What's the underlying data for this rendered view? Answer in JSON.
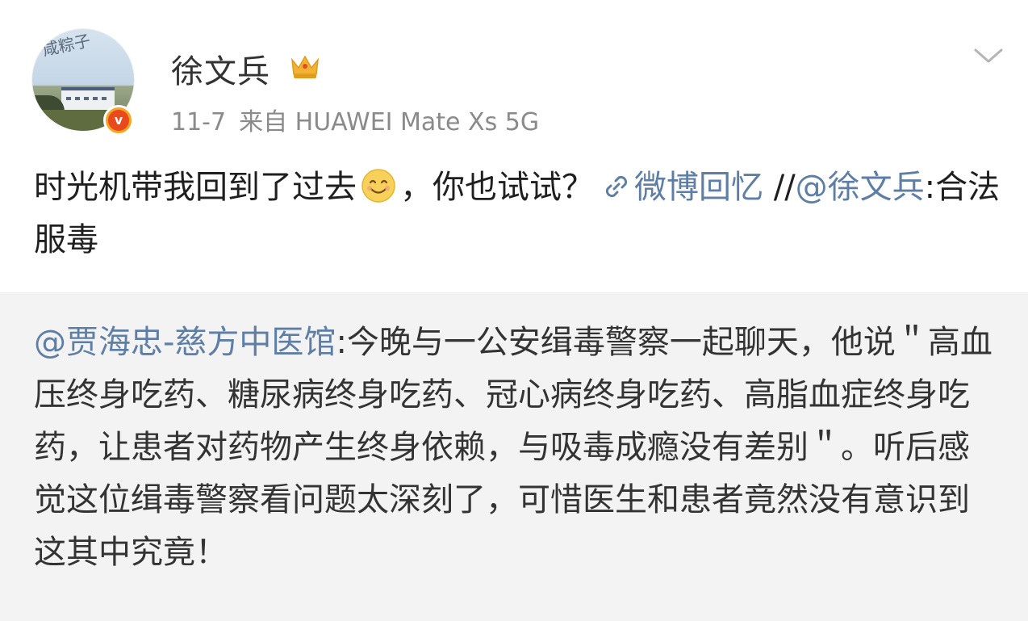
{
  "author": {
    "name": "徐文兵",
    "avatar_tag": "咸粽子",
    "verified": true,
    "verified_badge": "v"
  },
  "meta": {
    "date": "11-7",
    "source": "来自 HUAWEI Mate Xs 5G"
  },
  "post": {
    "text_part1": "时光机带我回到了过去",
    "text_part2": "，你也试试？",
    "link_label": "微博回忆",
    "repost_prefix": " //",
    "repost_mention": "@徐文兵",
    "repost_text": ":合法服毒"
  },
  "quote": {
    "mention": "@贾海忠-慈方中医馆",
    "text": ":今晚与一公安缉毒警察一起聊天，他说＂高血压终身吃药、糖尿病终身吃药、冠心病终身吃药、高脂血症终身吃药，让患者对药物产生终身依赖，与吸毒成瘾没有差别＂。听后感觉这位缉毒警察看问题太深刻了，可惜医生和患者竟然没有意识到这其中究竟！"
  },
  "icons": {
    "crown": "crown-icon",
    "chevron": "chevron-down-icon",
    "emoji": "smile-emoji-icon",
    "link": "link-icon"
  },
  "colors": {
    "link": "#5f7ea6",
    "meta": "#8a8a8a",
    "quote_bg": "#f3f3f3",
    "badge": "#f5a623"
  }
}
